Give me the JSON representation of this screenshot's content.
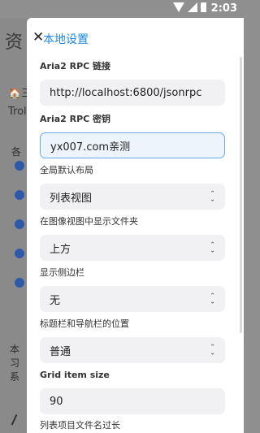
{
  "status_bar": {
    "time": "2:03"
  },
  "background": {
    "title": "资",
    "row1": "🏠三",
    "trol": "Trol",
    "ge": "各",
    "bottom_lines": [
      "本",
      "习",
      "系"
    ]
  },
  "sheet": {
    "title": "本地设置",
    "fields": [
      {
        "label": "Aria2 RPC 链接",
        "value": "http://localhost:6800/jsonrpc",
        "type": "text"
      },
      {
        "label": "Aria2 RPC 密钥",
        "value": "yx007.com亲测",
        "type": "text-active"
      },
      {
        "label": "全局默认布局",
        "value": "列表视图",
        "type": "select"
      },
      {
        "label": "在图像视图中显示文件夹",
        "value": "上方",
        "type": "select"
      },
      {
        "label": "显示侧边栏",
        "value": "无",
        "type": "select"
      },
      {
        "label": "标题栏和导航栏的位置",
        "value": "普通",
        "type": "select"
      },
      {
        "label": "Grid item size",
        "value": "90",
        "type": "text"
      },
      {
        "label": "列表项目文件名过长",
        "value": "",
        "type": "label-only"
      }
    ]
  }
}
